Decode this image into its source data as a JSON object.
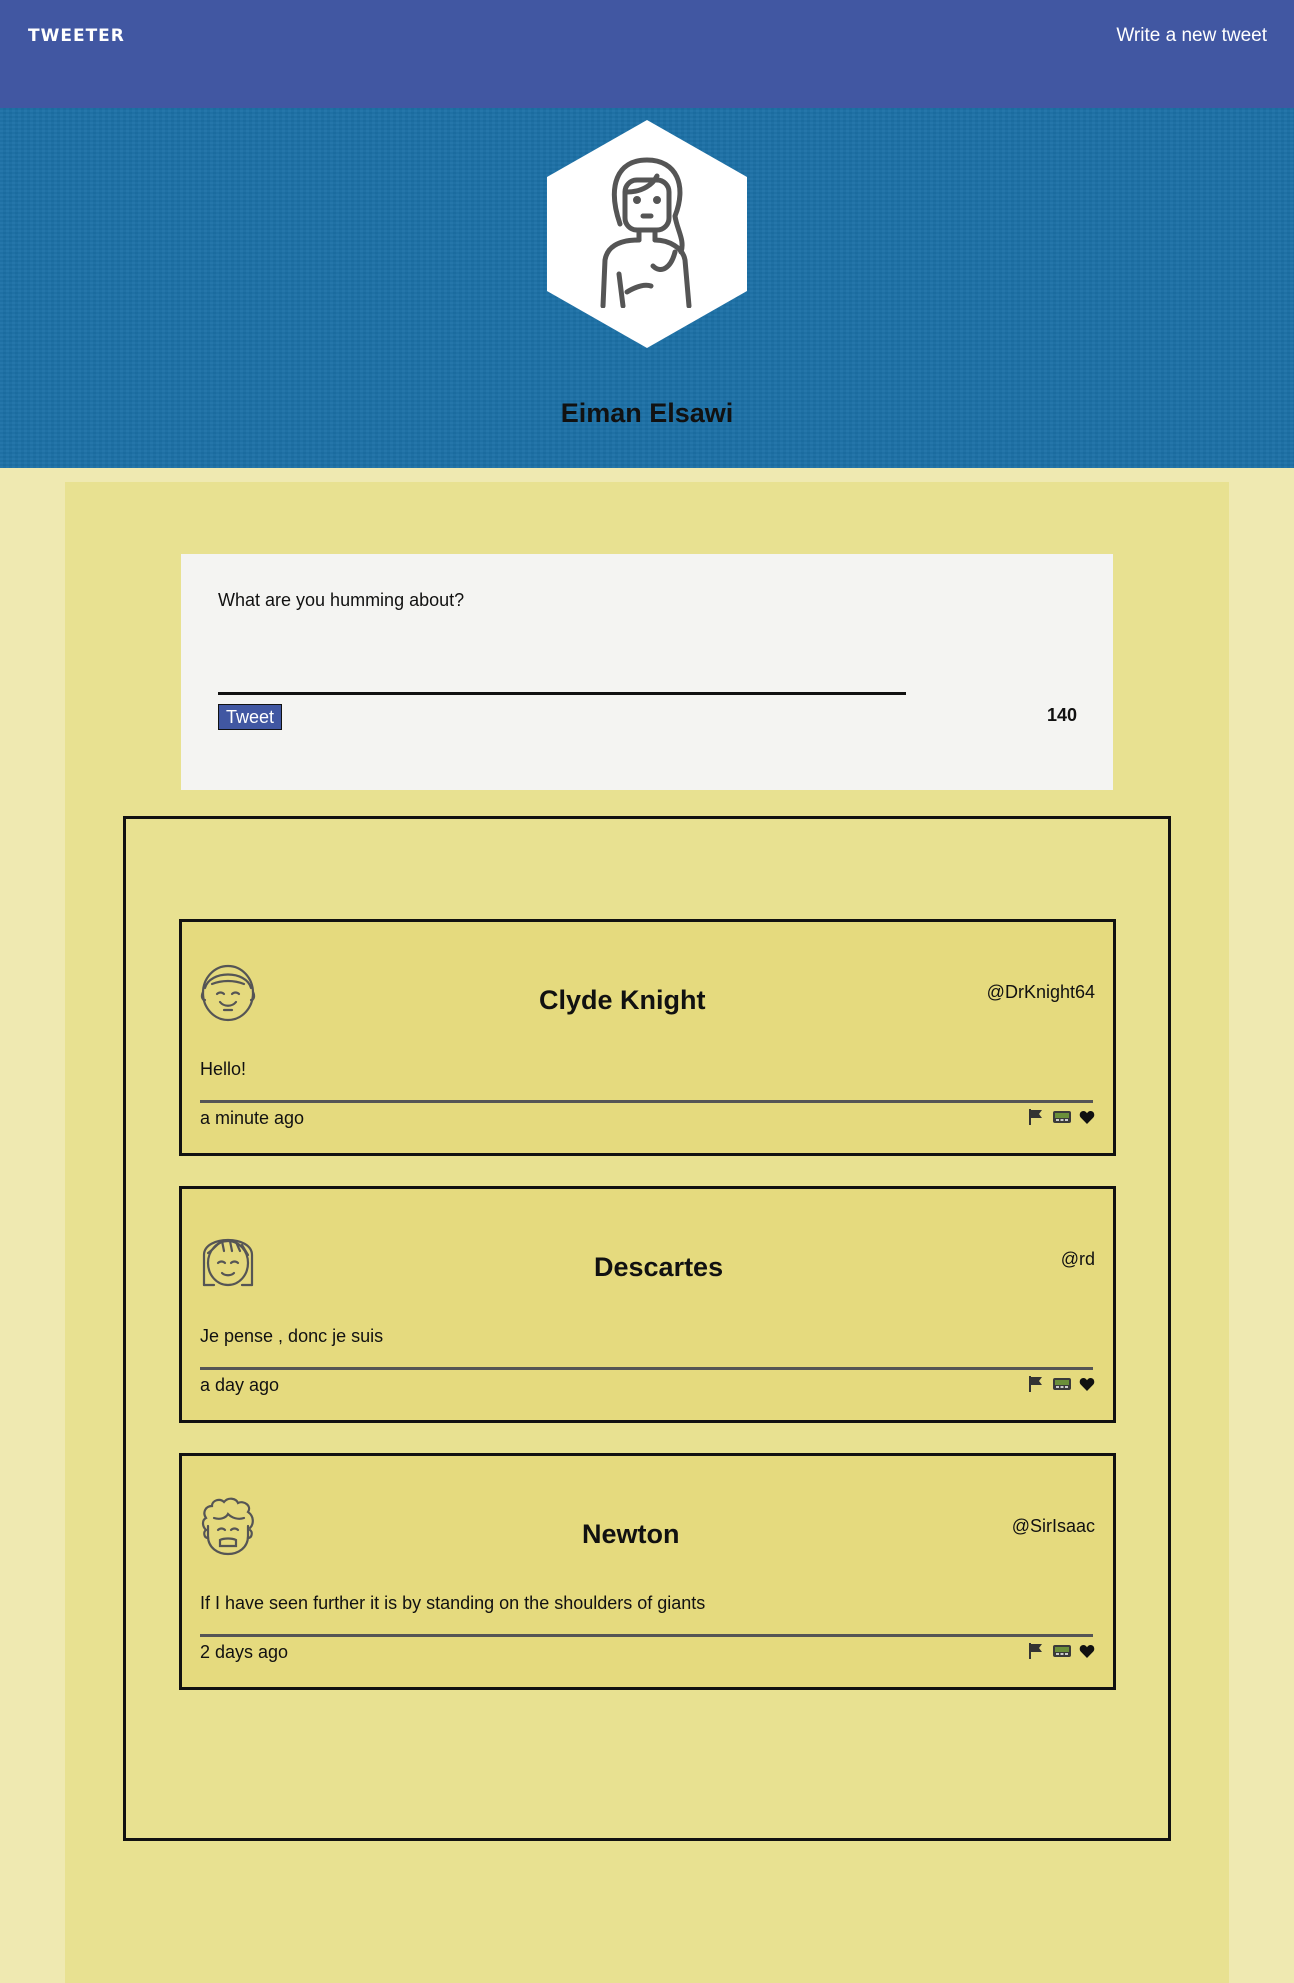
{
  "nav": {
    "brand": "TWEETER",
    "compose_link": "Write a new tweet"
  },
  "profile": {
    "name": "Eiman Elsawi",
    "avatar_icon": "woman-avatar-icon"
  },
  "composer": {
    "prompt": "What are you humming about?",
    "button_label": "Tweet",
    "counter": "140"
  },
  "tweets": [
    {
      "author": "Clyde Knight",
      "handle": "@DrKnight64",
      "content": "Hello!",
      "time": "a minute ago",
      "avatar_icon": "smiling-man-avatar-icon"
    },
    {
      "author": "Descartes",
      "handle": "@rd",
      "content": "Je pense , donc je suis",
      "time": "a day ago",
      "avatar_icon": "bob-hair-avatar-icon"
    },
    {
      "author": "Newton",
      "handle": "@SirIsaac",
      "content": "If I have seen further it is by standing on the shoulders of giants",
      "time": "2 days ago",
      "avatar_icon": "curly-hair-avatar-icon"
    }
  ],
  "actions": [
    "flag-icon",
    "retweet-icon",
    "heart-icon"
  ],
  "colors": {
    "nav": "#4157a2",
    "header": "#1c70a6",
    "page": "#efe9b1",
    "main": "#e8e191",
    "tweet_card": "#e5da7e",
    "composer": "#f4f4f2"
  }
}
